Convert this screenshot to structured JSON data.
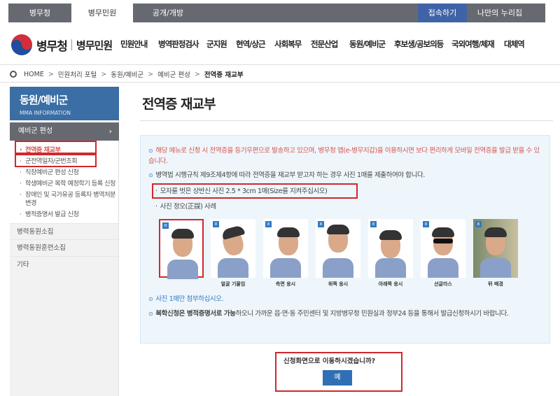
{
  "topnav": {
    "tabs": [
      "병무청",
      "병무민원",
      "공개/개방"
    ],
    "right_buttons": [
      "접속하기",
      "나만의 누리집"
    ]
  },
  "header": {
    "logo_main": "병무청",
    "logo_sub": "병무민원",
    "menu": [
      "민원안내",
      "병역판정검사",
      "군지원",
      "현역/상근",
      "사회복무",
      "전문산업",
      "동원/예비군",
      "후보생/공보의등",
      "국외여행/체재",
      "대체역"
    ]
  },
  "breadcrumb": {
    "items": [
      "HOME",
      "민원처리 포털",
      "동원/예비군",
      "예비군 편성",
      "전역증 재교부"
    ]
  },
  "sidebar": {
    "title": "동원/예비군",
    "subtitle": "MMA INFORMATION",
    "active_section": "예비군 편성",
    "sub_items": [
      "전역증 재교부",
      "군전역일자/군번조회",
      "직장예비군 편성 신청",
      "학생예비군 복학 예정학기 등록 신청",
      "장애인 및 국가유공 등록자 병역처분변경",
      "병적증명서 발급 신청"
    ],
    "menus": [
      "병력동원소집",
      "병력동원훈련소집",
      "기타"
    ]
  },
  "main": {
    "title": "전역증 재교부",
    "notice_1": "해당 메뉴로 신청 시 전역증을 등기우편으로 발송하고 있으며, 병무청 앱(e-병무지갑)을 이용하시면 보다 편리하게 모바일 전역증을 발급 받을 수 있습니다.",
    "notice_2": "병역법 시행규칙 제9조제4항에 따라 전역증을 재교부 받고자 하는 경우 사진 1매를 제출하여야 합니다.",
    "photo_spec": "모자를 벗은 상반신 사진 2.5 * 3cm 1매(Size를 지켜주십시오)",
    "photo_example_label": "사진 정오(正誤) 사례",
    "photos": [
      {
        "caption": "",
        "mark": "o"
      },
      {
        "caption": "얼굴 기울임",
        "mark": "x"
      },
      {
        "caption": "측면 응시",
        "mark": "x"
      },
      {
        "caption": "위쪽 응시",
        "mark": "x"
      },
      {
        "caption": "아래쪽 응시",
        "mark": "x"
      },
      {
        "caption": "선글라스",
        "mark": "x"
      },
      {
        "caption": "뒤 배경",
        "mark": "x"
      }
    ],
    "notice_3": "사진 1매만 첨부하십시오.",
    "notice_4_bold": "복학신청은 병적증명서로 가능",
    "notice_4_rest": "하오니 가까운 읍·면·동 주민센터 및 지방병무청 민원실과 정부24 등을 통해서 발급신청하시기 바랍니다.",
    "confirm_question": "신청화면으로 이동하시겠습니까?",
    "confirm_button": "예"
  },
  "colors": {
    "topbar": "#666a70",
    "sidebar_head": "#3a6ea5",
    "highlight": "#d0282e",
    "button": "#2f6fb5",
    "info_bg": "#eef6fb"
  }
}
